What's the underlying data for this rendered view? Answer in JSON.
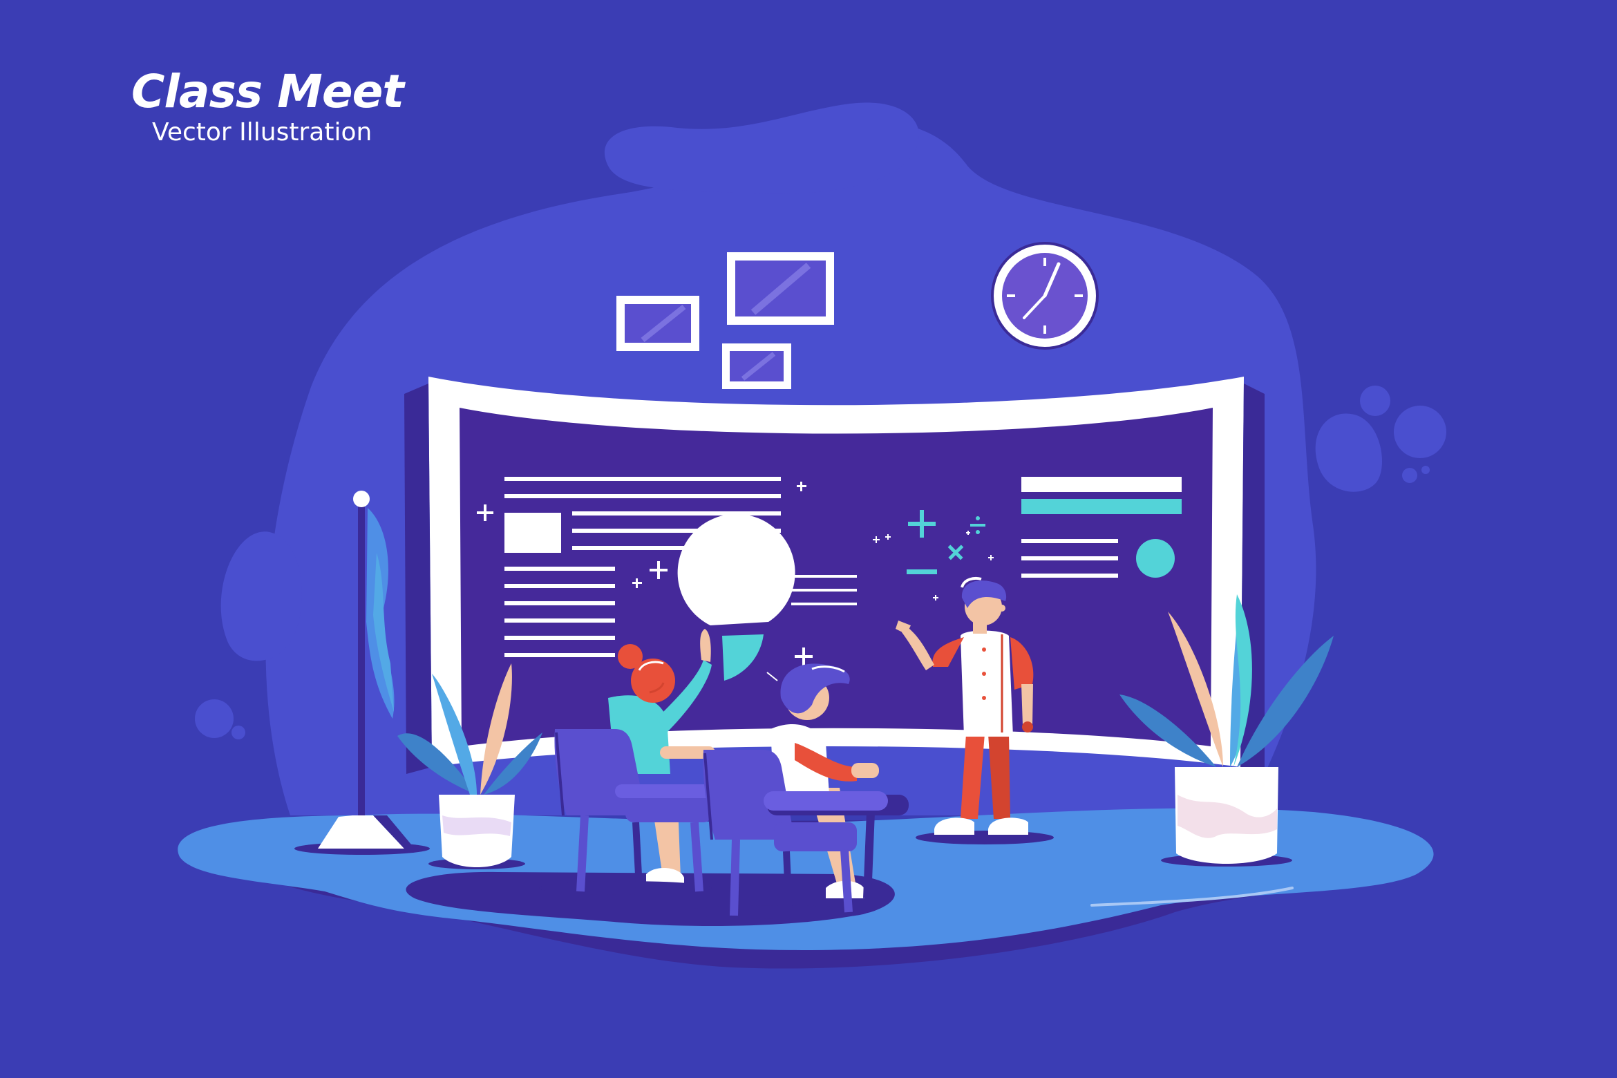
{
  "header": {
    "title": "Class Meet",
    "subtitle": "Vector Illustration"
  },
  "colors": {
    "background": "#3b3db4",
    "blob": "#4a4fcf",
    "screen": "#45299a",
    "floor_light": "#4f8fe6",
    "floor_dark": "#3a2a97",
    "accent_cyan": "#53d3d8",
    "accent_red": "#e8503a",
    "chair": "#5a4fcf",
    "white": "#ffffff"
  },
  "icons": [
    "clock-icon",
    "picture-frame-icon",
    "flag-icon",
    "plant-icon",
    "pie-chart-icon",
    "plus-icon",
    "minus-icon",
    "multiply-icon",
    "divide-icon"
  ]
}
